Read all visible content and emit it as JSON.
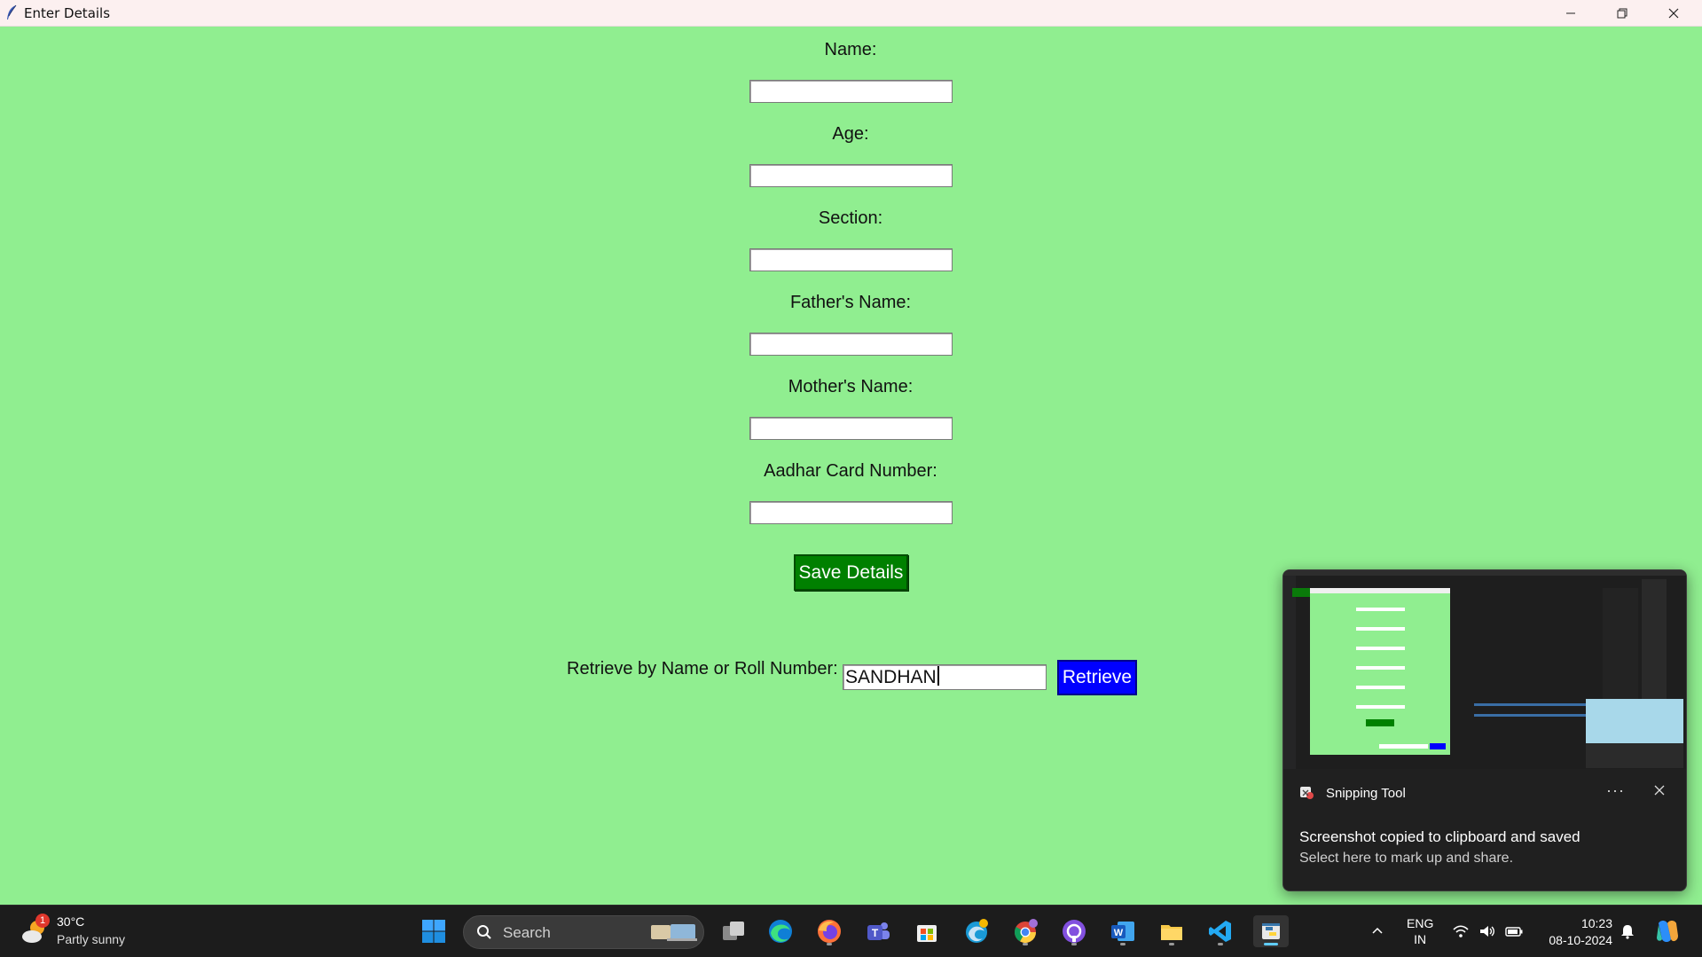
{
  "window": {
    "title": "Enter Details"
  },
  "form": {
    "fields": [
      {
        "label": "Name:",
        "value": ""
      },
      {
        "label": "Age:",
        "value": ""
      },
      {
        "label": "Section:",
        "value": ""
      },
      {
        "label": "Father's Name:",
        "value": ""
      },
      {
        "label": "Mother's Name:",
        "value": ""
      },
      {
        "label": "Aadhar Card Number:",
        "value": ""
      }
    ],
    "save_label": "Save Details",
    "retrieve_label": "Retrieve by Name or Roll Number:",
    "retrieve_value": "SANDHAN",
    "retrieve_button": "Retrieve"
  },
  "colors": {
    "background": "#90ee90",
    "save_button": "#008000",
    "retrieve_button": "#0000ff"
  },
  "toast": {
    "app_name": "Snipping Tool",
    "more": "···",
    "title": "Screenshot copied to clipboard and saved",
    "body": "Select here to mark up and share."
  },
  "taskbar": {
    "weather": {
      "badge": "1",
      "temp": "30°C",
      "desc": "Partly sunny"
    },
    "search_placeholder": "Search",
    "apps": [
      "windows-start",
      "task-view",
      "edge",
      "firefox",
      "teams",
      "microsoft-store",
      "edge-dev",
      "chrome",
      "github-desktop",
      "word",
      "file-explorer",
      "vscode",
      "python"
    ],
    "language": {
      "line1": "ENG",
      "line2": "IN"
    },
    "clock": {
      "time": "10:23",
      "date": "08-10-2024"
    }
  }
}
